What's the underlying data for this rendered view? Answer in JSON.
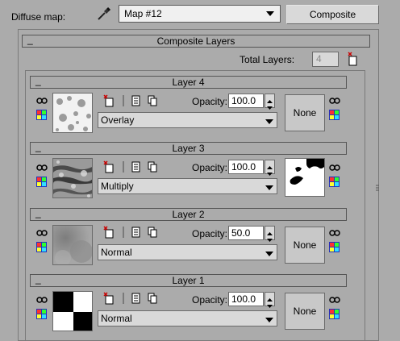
{
  "header": {
    "diffuse_label": "Diffuse map:",
    "map_name": "Map #12",
    "type_button": "Composite"
  },
  "composite_rollout": {
    "minimize": "_",
    "title": "Composite Layers",
    "total_layers_label": "Total Layers:",
    "total_layers_value": "4"
  },
  "layers": [
    {
      "minimize": "_",
      "title": "Layer 4",
      "opacity_label": "Opacity:",
      "opacity": "100.0",
      "blend_mode": "Overlay",
      "mask_label": "None"
    },
    {
      "minimize": "_",
      "title": "Layer 3",
      "opacity_label": "Opacity:",
      "opacity": "100.0",
      "blend_mode": "Multiply",
      "mask_label": ""
    },
    {
      "minimize": "_",
      "title": "Layer 2",
      "opacity_label": "Opacity:",
      "opacity": "50.0",
      "blend_mode": "Normal",
      "mask_label": "None"
    },
    {
      "minimize": "_",
      "title": "Layer 1",
      "opacity_label": "Opacity:",
      "opacity": "100.0",
      "blend_mode": "Normal",
      "mask_label": "None"
    }
  ],
  "icons": {
    "visibility": "eye-chain-icon",
    "color_correct": "color-correct-icon",
    "new_layer": "new-layer-icon",
    "rename": "rename-icon",
    "duplicate": "duplicate-icon",
    "eyedropper": "eyedropper-icon",
    "add_layer": "add-layer-icon"
  },
  "colors": {
    "panel_bg": "#ababab",
    "field_bg": "#d8d8d8"
  }
}
